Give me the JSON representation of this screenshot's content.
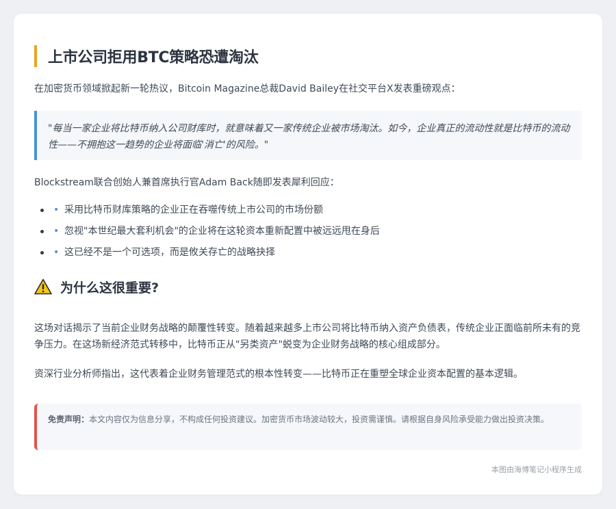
{
  "article": {
    "title": "上市公司拒用BTC策略恐遭淘汰",
    "intro": "在加密货币领域掀起新一轮热议，Bitcoin Magazine总裁David Bailey在社交平台X发表重磅观点：",
    "quote": "\"每当一家企业将比特币纳入公司财库时，就意味着又一家传统企业被市场淘汰。如今，企业真正的流动性就是比特币的流动性——不拥抱这一趋势的企业将面临'消亡'的风险。\"",
    "response_intro": "Blockstream联合创始人兼首席执行官Adam Back随即发表犀利回应：",
    "bullets": [
      "采用比特币财库策略的企业正在吞噬传统上市公司的市场份额",
      "忽视\"本世纪最大套利机会\"的企业将在这轮资本重新配置中被远远甩在身后",
      "这已经不是一个可选项，而是攸关存亡的战略抉择"
    ],
    "bullet_marker": "•",
    "section_title": "为什么这很重要?",
    "section_icon": "warning-icon",
    "paragraphs": [
      "这场对话揭示了当前企业财务战略的颠覆性转变。随着越来越多上市公司将比特币纳入资产负债表，传统企业正面临前所未有的竞争压力。在这场新经济范式转移中，比特币正从\"另类资产\"蜕变为企业财务战略的核心组成部分。",
      "资深行业分析师指出，这代表着企业财务管理范式的根本性转变——比特币正在重塑全球企业资本配置的基本逻辑。"
    ],
    "disclaimer_label": "免责声明：",
    "disclaimer_text": "本文内容仅为信息分享，不构成任何投资建议。加密货币市场波动较大，投资需谨慎。请根据自身风险承受能力做出投资决策。",
    "footer": "本图由海博笔记小程序生成"
  },
  "colors": {
    "title_accent": "#f0a020",
    "quote_accent": "#4a90d9",
    "disclaimer_accent": "#e0534a",
    "background": "#eef0f3"
  }
}
